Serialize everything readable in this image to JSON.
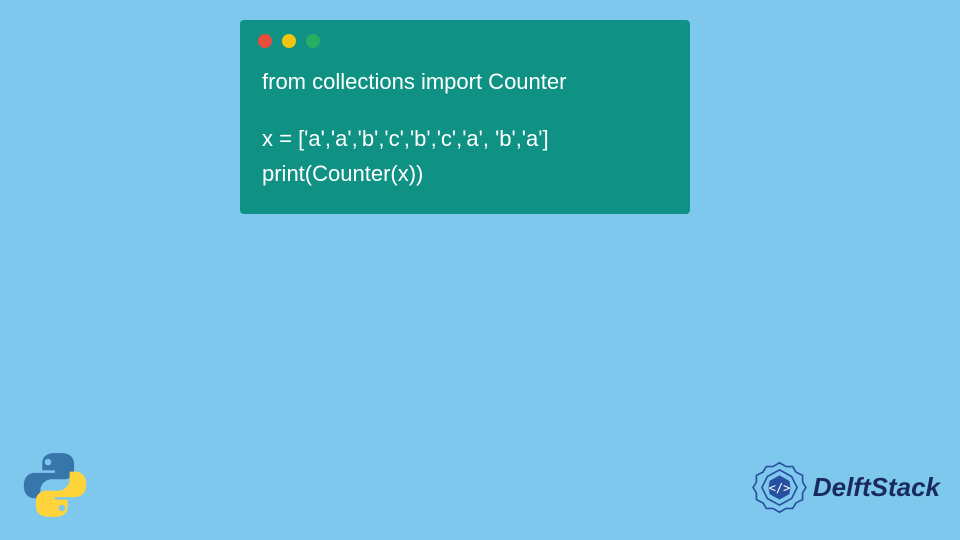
{
  "code": {
    "line1": "from collections import Counter",
    "line2": "x = ['a','a','b','c','b','c','a', 'b','a']",
    "line3": "print(Counter(x))"
  },
  "brand": {
    "name": "DelftStack"
  }
}
